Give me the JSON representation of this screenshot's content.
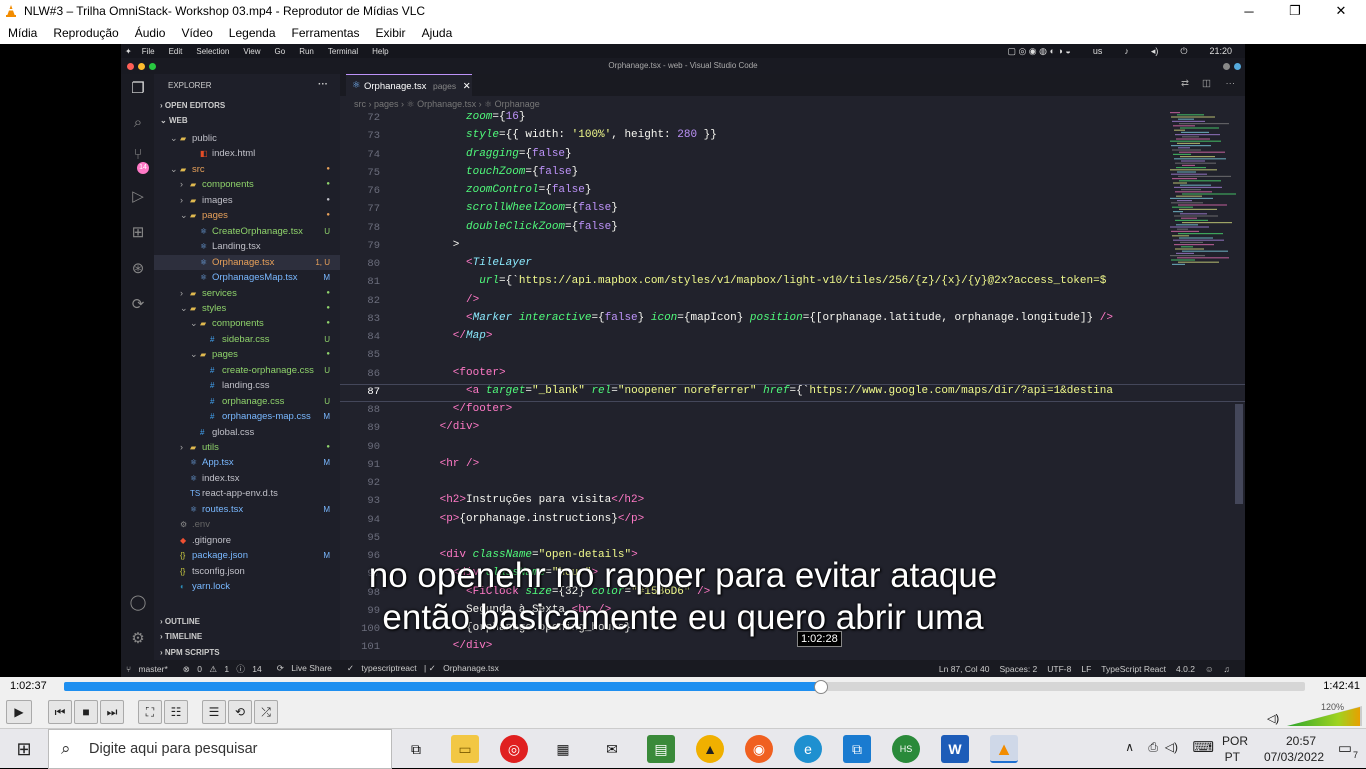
{
  "window": {
    "title": "NLW#3 – Trilha OmniStack- Workshop 03.mp4 - Reprodutor de Mídias VLC",
    "minimize": "─",
    "restore": "❐",
    "close": "✕"
  },
  "menu": [
    "Mídia",
    "Reprodução",
    "Áudio",
    "Vídeo",
    "Legenda",
    "Ferramentas",
    "Exibir",
    "Ajuda"
  ],
  "vscode": {
    "top_menu": [
      "File",
      "Edit",
      "Selection",
      "View",
      "Go",
      "Run",
      "Terminal",
      "Help"
    ],
    "clock": "21:20",
    "lang": "us",
    "window_title": "Orphanage.tsx - web - Visual Studio Code",
    "explorer_label": "EXPLORER",
    "sections": {
      "open_editors": "OPEN EDITORS",
      "web": "WEB",
      "outline": "OUTLINE",
      "timeline": "TIMELINE",
      "npm": "NPM SCRIPTS"
    },
    "activity_badge": "14",
    "tree": [
      {
        "label": "public",
        "indent": 1,
        "kind": "folder-open",
        "color": "gray"
      },
      {
        "label": "index.html",
        "indent": 3,
        "kind": "html",
        "color": "gray"
      },
      {
        "label": "src",
        "indent": 1,
        "kind": "folder-open",
        "color": "orange",
        "dot": true
      },
      {
        "label": "components",
        "indent": 2,
        "kind": "folder",
        "color": "green",
        "dot": true
      },
      {
        "label": "images",
        "indent": 2,
        "kind": "folder",
        "color": "gray",
        "dot": true
      },
      {
        "label": "pages",
        "indent": 2,
        "kind": "folder-open",
        "color": "orange",
        "dot": true
      },
      {
        "label": "CreateOrphanage.tsx",
        "indent": 3,
        "kind": "tsx",
        "color": "green",
        "badge": "U"
      },
      {
        "label": "Landing.tsx",
        "indent": 3,
        "kind": "tsx",
        "color": "gray"
      },
      {
        "label": "Orphanage.tsx",
        "indent": 3,
        "kind": "tsx",
        "color": "orange",
        "badge": "1, U",
        "active": true
      },
      {
        "label": "OrphanagesMap.tsx",
        "indent": 3,
        "kind": "tsx",
        "color": "blue",
        "badge": "M"
      },
      {
        "label": "services",
        "indent": 2,
        "kind": "folder",
        "color": "green",
        "dot": true
      },
      {
        "label": "styles",
        "indent": 2,
        "kind": "folder-open",
        "color": "green",
        "dot": true
      },
      {
        "label": "components",
        "indent": 3,
        "kind": "folder-open",
        "color": "green",
        "dot": true
      },
      {
        "label": "sidebar.css",
        "indent": 4,
        "kind": "css",
        "color": "green",
        "badge": "U"
      },
      {
        "label": "pages",
        "indent": 3,
        "kind": "folder-open",
        "color": "green",
        "dot": true
      },
      {
        "label": "create-orphanage.css",
        "indent": 4,
        "kind": "css",
        "color": "green",
        "badge": "U"
      },
      {
        "label": "landing.css",
        "indent": 4,
        "kind": "css",
        "color": "gray"
      },
      {
        "label": "orphanage.css",
        "indent": 4,
        "kind": "css",
        "color": "green",
        "badge": "U"
      },
      {
        "label": "orphanages-map.css",
        "indent": 4,
        "kind": "css",
        "color": "blue",
        "badge": "M"
      },
      {
        "label": "global.css",
        "indent": 3,
        "kind": "css",
        "color": "gray"
      },
      {
        "label": "utils",
        "indent": 2,
        "kind": "folder",
        "color": "green",
        "dot": true
      },
      {
        "label": "App.tsx",
        "indent": 2,
        "kind": "tsx",
        "color": "blue",
        "badge": "M"
      },
      {
        "label": "index.tsx",
        "indent": 2,
        "kind": "tsx",
        "color": "gray"
      },
      {
        "label": "react-app-env.d.ts",
        "indent": 2,
        "kind": "ts",
        "color": "gray"
      },
      {
        "label": "routes.tsx",
        "indent": 2,
        "kind": "tsx",
        "color": "blue",
        "badge": "M"
      },
      {
        "label": ".env",
        "indent": 1,
        "kind": "env",
        "color": "dim"
      },
      {
        "label": ".gitignore",
        "indent": 1,
        "kind": "git",
        "color": "gray"
      },
      {
        "label": "package.json",
        "indent": 1,
        "kind": "json",
        "color": "blue",
        "badge": "M"
      },
      {
        "label": "tsconfig.json",
        "indent": 1,
        "kind": "json",
        "color": "gray"
      },
      {
        "label": "yarn.lock",
        "indent": 1,
        "kind": "yarn",
        "color": "blue"
      }
    ],
    "tab": {
      "name": "Orphanage.tsx",
      "folder": "pages"
    },
    "breadcrumb": "src › pages › ⚛ Orphanage.tsx › ⚛ Orphanage",
    "code": [
      {
        "n": "72",
        "h": [
          [
            "zoom",
            "at"
          ],
          [
            "={",
            "pu"
          ],
          [
            "16",
            "nm"
          ],
          [
            "}",
            "pu"
          ]
        ],
        "i": 10
      },
      {
        "n": "73",
        "h": [
          [
            "style",
            "at"
          ],
          [
            "={{ width: ",
            "pu"
          ],
          [
            "'100%'",
            "st"
          ],
          [
            ", height: ",
            "pu"
          ],
          [
            "280",
            "nm"
          ],
          [
            " }}",
            "pu"
          ]
        ],
        "i": 10
      },
      {
        "n": "74",
        "h": [
          [
            "dragging",
            "at"
          ],
          [
            "={",
            "pu"
          ],
          [
            "false",
            "nm"
          ],
          [
            "}",
            "pu"
          ]
        ],
        "i": 10
      },
      {
        "n": "75",
        "h": [
          [
            "touchZoom",
            "at"
          ],
          [
            "={",
            "pu"
          ],
          [
            "false",
            "nm"
          ],
          [
            "}",
            "pu"
          ]
        ],
        "i": 10
      },
      {
        "n": "76",
        "h": [
          [
            "zoomControl",
            "at"
          ],
          [
            "={",
            "pu"
          ],
          [
            "false",
            "nm"
          ],
          [
            "}",
            "pu"
          ]
        ],
        "i": 10
      },
      {
        "n": "77",
        "h": [
          [
            "scrollWheelZoom",
            "at"
          ],
          [
            "={",
            "pu"
          ],
          [
            "false",
            "nm"
          ],
          [
            "}",
            "pu"
          ]
        ],
        "i": 10
      },
      {
        "n": "78",
        "h": [
          [
            "doubleClickZoom",
            "at"
          ],
          [
            "={",
            "pu"
          ],
          [
            "false",
            "nm"
          ],
          [
            "}",
            "pu"
          ]
        ],
        "i": 10
      },
      {
        "n": "79",
        "h": [
          [
            ">",
            "pu"
          ]
        ],
        "i": 8
      },
      {
        "n": "80",
        "h": [
          [
            "<",
            "tg"
          ],
          [
            "TileLayer",
            "cm"
          ]
        ],
        "i": 10
      },
      {
        "n": "81",
        "h": [
          [
            "url",
            "at"
          ],
          [
            "={`",
            "pu"
          ],
          [
            "https://api.mapbox.com/styles/v1/mapbox/light-v10/tiles/256/{z}/{x}/{y}@2x?access_token=$",
            "st"
          ]
        ],
        "i": 12
      },
      {
        "n": "82",
        "h": [
          [
            "/>",
            "tg"
          ]
        ],
        "i": 10
      },
      {
        "n": "83",
        "h": [
          [
            "<",
            "tg"
          ],
          [
            "Marker",
            "cm"
          ],
          [
            " ",
            "pu"
          ],
          [
            "interactive",
            "at"
          ],
          [
            "={",
            "pu"
          ],
          [
            "false",
            "nm"
          ],
          [
            "} ",
            "pu"
          ],
          [
            "icon",
            "at"
          ],
          [
            "={mapIcon} ",
            "pu"
          ],
          [
            "position",
            "at"
          ],
          [
            "={[orphanage.latitude, orphanage.longitude]} ",
            "pu"
          ],
          [
            "/>",
            "tg"
          ]
        ],
        "i": 10
      },
      {
        "n": "84",
        "h": [
          [
            "</",
            "tg"
          ],
          [
            "Map",
            "cm"
          ],
          [
            ">",
            "tg"
          ]
        ],
        "i": 8
      },
      {
        "n": "85",
        "h": [],
        "i": 0
      },
      {
        "n": "86",
        "h": [
          [
            "<footer>",
            "tg"
          ]
        ],
        "i": 8
      },
      {
        "n": "87",
        "h": [
          [
            "<a ",
            "tg"
          ],
          [
            "target",
            "at"
          ],
          [
            "=",
            "pu"
          ],
          [
            "\"_blank\"",
            "st"
          ],
          [
            " ",
            "pu"
          ],
          [
            "rel",
            "at"
          ],
          [
            "=",
            "pu"
          ],
          [
            "\"noopener noreferrer\"",
            "st"
          ],
          [
            " ",
            "pu"
          ],
          [
            "href",
            "at"
          ],
          [
            "={`",
            "pu"
          ],
          [
            "https://www.google.com/maps/dir/?api=1&destina",
            "st"
          ]
        ],
        "i": 10,
        "cur": true
      },
      {
        "n": "88",
        "h": [
          [
            "</footer>",
            "tg"
          ]
        ],
        "i": 8
      },
      {
        "n": "89",
        "h": [
          [
            "</div>",
            "tg"
          ]
        ],
        "i": 6
      },
      {
        "n": "90",
        "h": [],
        "i": 0
      },
      {
        "n": "91",
        "h": [
          [
            "<hr />",
            "tg"
          ]
        ],
        "i": 6
      },
      {
        "n": "92",
        "h": [],
        "i": 0
      },
      {
        "n": "93",
        "h": [
          [
            "<h2>",
            "tg"
          ],
          [
            "Instruções para visita",
            "pu"
          ],
          [
            "</h2>",
            "tg"
          ]
        ],
        "i": 6
      },
      {
        "n": "94",
        "h": [
          [
            "<p>",
            "tg"
          ],
          [
            "{orphanage.instructions}",
            "pu"
          ],
          [
            "</p>",
            "tg"
          ]
        ],
        "i": 6
      },
      {
        "n": "95",
        "h": [],
        "i": 0
      },
      {
        "n": "96",
        "h": [
          [
            "<div ",
            "tg"
          ],
          [
            "className",
            "at"
          ],
          [
            "=",
            "pu"
          ],
          [
            "\"open-details\"",
            "st"
          ],
          [
            ">",
            "tg"
          ]
        ],
        "i": 6
      },
      {
        "n": "97",
        "h": [
          [
            "<div ",
            "tg"
          ],
          [
            "className",
            "at"
          ],
          [
            "=",
            "pu"
          ],
          [
            "\"hour\"",
            "st"
          ],
          [
            ">",
            "tg"
          ]
        ],
        "i": 8
      },
      {
        "n": "98",
        "h": [
          [
            "<FiClock ",
            "tg"
          ],
          [
            "size",
            "at"
          ],
          [
            "={32} ",
            "pu"
          ],
          [
            "color",
            "at"
          ],
          [
            "=",
            "pu"
          ],
          [
            "\"#15B6D6\"",
            "st"
          ],
          [
            " />",
            "tg"
          ]
        ],
        "i": 10
      },
      {
        "n": "99",
        "h": [
          [
            "Segunda à Sexta ",
            "pu"
          ],
          [
            "<br />",
            "tg"
          ]
        ],
        "i": 10
      },
      {
        "n": "100",
        "h": [
          [
            "{orphanage.opening_hours}",
            "pu"
          ]
        ],
        "i": 10
      },
      {
        "n": "101",
        "h": [
          [
            "</div>",
            "tg"
          ]
        ],
        "i": 8
      }
    ],
    "status": {
      "branch": "master*",
      "errors": "0",
      "warnings": "1",
      "info": "14",
      "live": "Live Share",
      "lang_mode": "typescriptreact",
      "file": "Orphanage.tsx",
      "pos": "Ln 87, Col 40",
      "spaces": "Spaces: 2",
      "enc": "UTF-8",
      "eol": "LF",
      "lang": "TypeScript React",
      "ver": "4.0.2"
    }
  },
  "subtitles": {
    "line1": "no openehr no rapper para evitar ataque",
    "line2": "então basicamente eu quero abrir uma"
  },
  "hover_time": "1:02:28",
  "player": {
    "elapsed": "1:02:37",
    "total": "1:42:41",
    "progress": 0.61,
    "volume_label": "120%"
  },
  "taskbar": {
    "search_placeholder": "Digite aqui para pesquisar",
    "lang1": "POR",
    "lang2": "PT",
    "time": "20:57",
    "date": "07/03/2022",
    "notifications": "7"
  },
  "colors": {
    "accent": "#1e8ff0",
    "vlc_orange": "#f28c00",
    "vscode_bg": "#21222c"
  }
}
